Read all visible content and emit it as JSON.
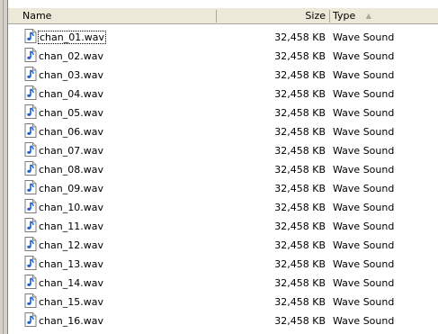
{
  "columns": {
    "name": "Name",
    "size": "Size",
    "type": "Type",
    "sort_indicator": "sort-ascending-arrow"
  },
  "files": [
    {
      "name": "chan_01.wav",
      "size": "32,458 KB",
      "type": "Wave Sound",
      "selected": true
    },
    {
      "name": "chan_02.wav",
      "size": "32,458 KB",
      "type": "Wave Sound"
    },
    {
      "name": "chan_03.wav",
      "size": "32,458 KB",
      "type": "Wave Sound"
    },
    {
      "name": "chan_04.wav",
      "size": "32,458 KB",
      "type": "Wave Sound"
    },
    {
      "name": "chan_05.wav",
      "size": "32,458 KB",
      "type": "Wave Sound"
    },
    {
      "name": "chan_06.wav",
      "size": "32,458 KB",
      "type": "Wave Sound"
    },
    {
      "name": "chan_07.wav",
      "size": "32,458 KB",
      "type": "Wave Sound"
    },
    {
      "name": "chan_08.wav",
      "size": "32,458 KB",
      "type": "Wave Sound"
    },
    {
      "name": "chan_09.wav",
      "size": "32,458 KB",
      "type": "Wave Sound"
    },
    {
      "name": "chan_10.wav",
      "size": "32,458 KB",
      "type": "Wave Sound"
    },
    {
      "name": "chan_11.wav",
      "size": "32,458 KB",
      "type": "Wave Sound"
    },
    {
      "name": "chan_12.wav",
      "size": "32,458 KB",
      "type": "Wave Sound"
    },
    {
      "name": "chan_13.wav",
      "size": "32,458 KB",
      "type": "Wave Sound"
    },
    {
      "name": "chan_14.wav",
      "size": "32,458 KB",
      "type": "Wave Sound"
    },
    {
      "name": "chan_15.wav",
      "size": "32,458 KB",
      "type": "Wave Sound"
    },
    {
      "name": "chan_16.wav",
      "size": "32,458 KB",
      "type": "Wave Sound"
    }
  ],
  "file_icon": "wave-sound-file-icon",
  "colors": {
    "header_bg": "#ece9d8",
    "icon_blue": "#2a6fd6"
  }
}
